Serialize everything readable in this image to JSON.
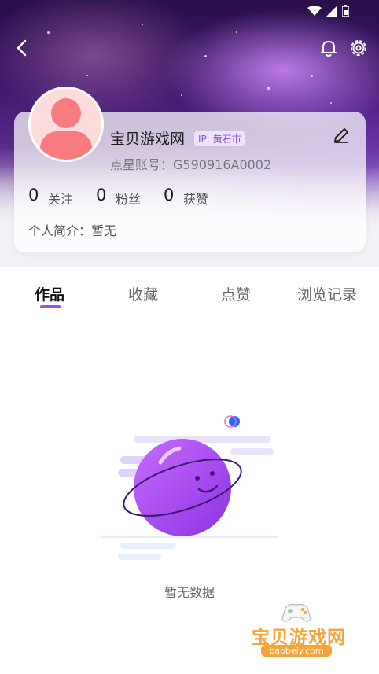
{
  "profile": {
    "name": "宝贝游戏网",
    "ip_label": "IP: 黄石市",
    "account_label": "点星账号：",
    "account_id": "G590916A0002",
    "bio_label": "个人简介：",
    "bio_value": "暂无"
  },
  "stats": [
    {
      "value": "0",
      "label": "关注"
    },
    {
      "value": "0",
      "label": "粉丝"
    },
    {
      "value": "0",
      "label": "获赞"
    }
  ],
  "tabs": [
    {
      "label": "作品",
      "active": true
    },
    {
      "label": "收藏"
    },
    {
      "label": "点赞"
    },
    {
      "label": "浏览记录"
    }
  ],
  "empty_state": {
    "text": "暂无数据"
  },
  "watermark": {
    "title": "宝贝游戏网",
    "url": "baobeiy.com"
  },
  "icons": [
    "back-arrow-icon",
    "bell-icon",
    "gear-icon",
    "edit-pencil-icon",
    "wifi-icon",
    "signal-icon",
    "battery-icon"
  ],
  "colors": {
    "accent": "#9a4ff0",
    "avatar": "#f77b7f",
    "ip_badge_bg": "#efe3ff"
  }
}
